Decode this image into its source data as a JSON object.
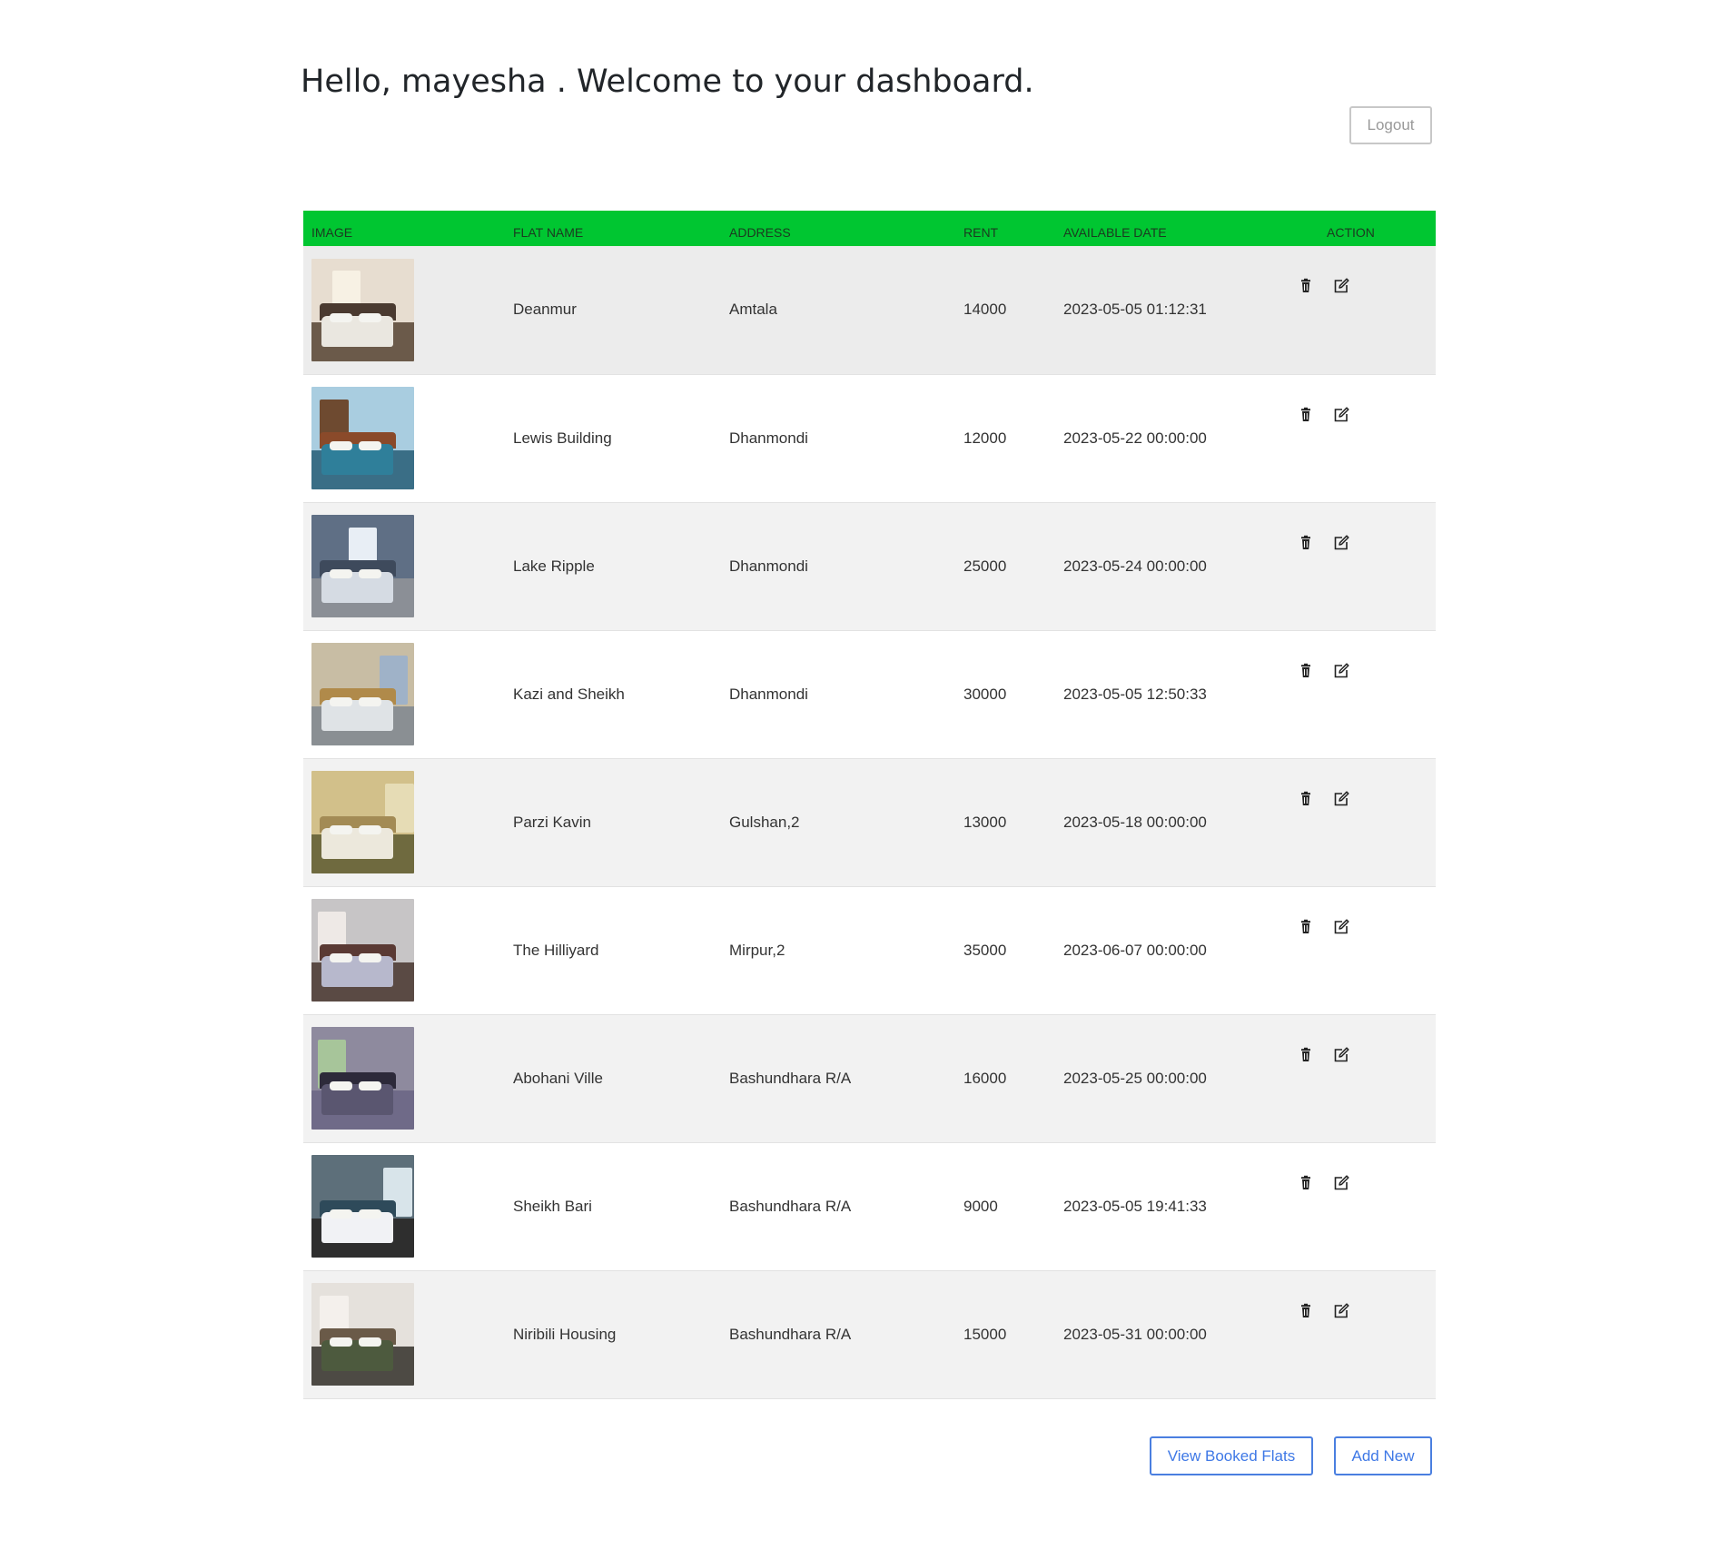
{
  "header": {
    "greeting": "Hello, mayesha . Welcome to your dashboard.",
    "logout_label": "Logout"
  },
  "table": {
    "columns": [
      "IMAGE",
      "FLAT NAME",
      "ADDRESS",
      "RENT",
      "AVAILABLE DATE",
      "ACTION"
    ],
    "rows": [
      {
        "name": "Deanmur",
        "address": "Amtala",
        "rent": "14000",
        "date": "2023-05-05 01:12:31"
      },
      {
        "name": "Lewis Building",
        "address": "Dhanmondi",
        "rent": "12000",
        "date": "2023-05-22 00:00:00"
      },
      {
        "name": "Lake Ripple",
        "address": "Dhanmondi",
        "rent": "25000",
        "date": "2023-05-24 00:00:00"
      },
      {
        "name": "Kazi and Sheikh",
        "address": "Dhanmondi",
        "rent": "30000",
        "date": "2023-05-05 12:50:33"
      },
      {
        "name": "Parzi Kavin",
        "address": "Gulshan,2",
        "rent": "13000",
        "date": "2023-05-18 00:00:00"
      },
      {
        "name": "The Hilliyard",
        "address": "Mirpur,2",
        "rent": "35000",
        "date": "2023-06-07 00:00:00"
      },
      {
        "name": "Abohani Ville",
        "address": "Bashundhara R/A",
        "rent": "16000",
        "date": "2023-05-25 00:00:00"
      },
      {
        "name": "Sheikh Bari",
        "address": "Bashundhara R/A",
        "rent": "9000",
        "date": "2023-05-05 19:41:33"
      },
      {
        "name": "Niribili Housing",
        "address": "Bashundhara R/A",
        "rent": "15000",
        "date": "2023-05-31 00:00:00"
      }
    ]
  },
  "footer": {
    "view_booked_label": "View Booked Flats",
    "add_new_label": "Add New"
  },
  "icons": {
    "delete": "trash-icon",
    "edit": "edit-icon"
  },
  "colors": {
    "header_bg": "#00c631",
    "accent_blue": "#3e78e6",
    "row_alt": "#f2f2f2"
  }
}
